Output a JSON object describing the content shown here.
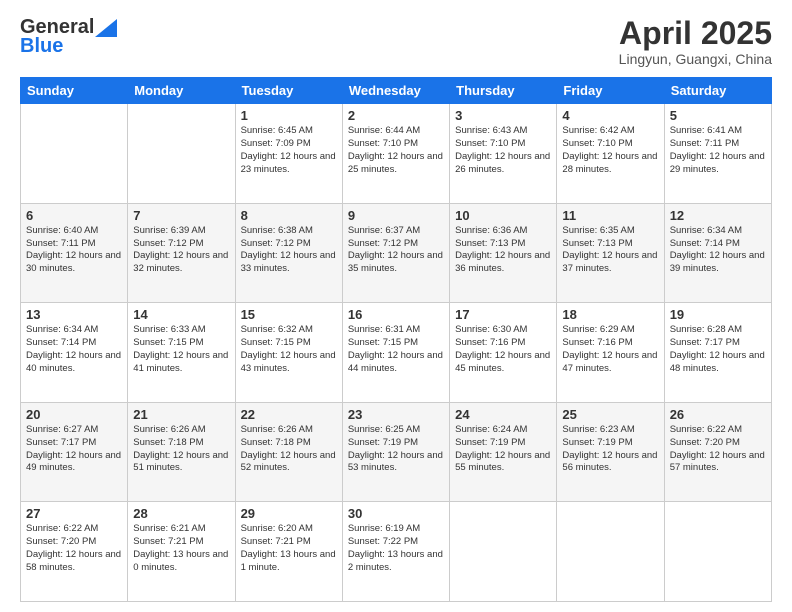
{
  "header": {
    "logo": {
      "general": "General",
      "blue": "Blue"
    },
    "title": "April 2025",
    "location": "Lingyun, Guangxi, China"
  },
  "days_of_week": [
    "Sunday",
    "Monday",
    "Tuesday",
    "Wednesday",
    "Thursday",
    "Friday",
    "Saturday"
  ],
  "weeks": [
    [
      {
        "day": "",
        "info": ""
      },
      {
        "day": "",
        "info": ""
      },
      {
        "day": "1",
        "info": "Sunrise: 6:45 AM\nSunset: 7:09 PM\nDaylight: 12 hours and 23 minutes."
      },
      {
        "day": "2",
        "info": "Sunrise: 6:44 AM\nSunset: 7:10 PM\nDaylight: 12 hours and 25 minutes."
      },
      {
        "day": "3",
        "info": "Sunrise: 6:43 AM\nSunset: 7:10 PM\nDaylight: 12 hours and 26 minutes."
      },
      {
        "day": "4",
        "info": "Sunrise: 6:42 AM\nSunset: 7:10 PM\nDaylight: 12 hours and 28 minutes."
      },
      {
        "day": "5",
        "info": "Sunrise: 6:41 AM\nSunset: 7:11 PM\nDaylight: 12 hours and 29 minutes."
      }
    ],
    [
      {
        "day": "6",
        "info": "Sunrise: 6:40 AM\nSunset: 7:11 PM\nDaylight: 12 hours and 30 minutes."
      },
      {
        "day": "7",
        "info": "Sunrise: 6:39 AM\nSunset: 7:12 PM\nDaylight: 12 hours and 32 minutes."
      },
      {
        "day": "8",
        "info": "Sunrise: 6:38 AM\nSunset: 7:12 PM\nDaylight: 12 hours and 33 minutes."
      },
      {
        "day": "9",
        "info": "Sunrise: 6:37 AM\nSunset: 7:12 PM\nDaylight: 12 hours and 35 minutes."
      },
      {
        "day": "10",
        "info": "Sunrise: 6:36 AM\nSunset: 7:13 PM\nDaylight: 12 hours and 36 minutes."
      },
      {
        "day": "11",
        "info": "Sunrise: 6:35 AM\nSunset: 7:13 PM\nDaylight: 12 hours and 37 minutes."
      },
      {
        "day": "12",
        "info": "Sunrise: 6:34 AM\nSunset: 7:14 PM\nDaylight: 12 hours and 39 minutes."
      }
    ],
    [
      {
        "day": "13",
        "info": "Sunrise: 6:34 AM\nSunset: 7:14 PM\nDaylight: 12 hours and 40 minutes."
      },
      {
        "day": "14",
        "info": "Sunrise: 6:33 AM\nSunset: 7:15 PM\nDaylight: 12 hours and 41 minutes."
      },
      {
        "day": "15",
        "info": "Sunrise: 6:32 AM\nSunset: 7:15 PM\nDaylight: 12 hours and 43 minutes."
      },
      {
        "day": "16",
        "info": "Sunrise: 6:31 AM\nSunset: 7:15 PM\nDaylight: 12 hours and 44 minutes."
      },
      {
        "day": "17",
        "info": "Sunrise: 6:30 AM\nSunset: 7:16 PM\nDaylight: 12 hours and 45 minutes."
      },
      {
        "day": "18",
        "info": "Sunrise: 6:29 AM\nSunset: 7:16 PM\nDaylight: 12 hours and 47 minutes."
      },
      {
        "day": "19",
        "info": "Sunrise: 6:28 AM\nSunset: 7:17 PM\nDaylight: 12 hours and 48 minutes."
      }
    ],
    [
      {
        "day": "20",
        "info": "Sunrise: 6:27 AM\nSunset: 7:17 PM\nDaylight: 12 hours and 49 minutes."
      },
      {
        "day": "21",
        "info": "Sunrise: 6:26 AM\nSunset: 7:18 PM\nDaylight: 12 hours and 51 minutes."
      },
      {
        "day": "22",
        "info": "Sunrise: 6:26 AM\nSunset: 7:18 PM\nDaylight: 12 hours and 52 minutes."
      },
      {
        "day": "23",
        "info": "Sunrise: 6:25 AM\nSunset: 7:19 PM\nDaylight: 12 hours and 53 minutes."
      },
      {
        "day": "24",
        "info": "Sunrise: 6:24 AM\nSunset: 7:19 PM\nDaylight: 12 hours and 55 minutes."
      },
      {
        "day": "25",
        "info": "Sunrise: 6:23 AM\nSunset: 7:19 PM\nDaylight: 12 hours and 56 minutes."
      },
      {
        "day": "26",
        "info": "Sunrise: 6:22 AM\nSunset: 7:20 PM\nDaylight: 12 hours and 57 minutes."
      }
    ],
    [
      {
        "day": "27",
        "info": "Sunrise: 6:22 AM\nSunset: 7:20 PM\nDaylight: 12 hours and 58 minutes."
      },
      {
        "day": "28",
        "info": "Sunrise: 6:21 AM\nSunset: 7:21 PM\nDaylight: 13 hours and 0 minutes."
      },
      {
        "day": "29",
        "info": "Sunrise: 6:20 AM\nSunset: 7:21 PM\nDaylight: 13 hours and 1 minute."
      },
      {
        "day": "30",
        "info": "Sunrise: 6:19 AM\nSunset: 7:22 PM\nDaylight: 13 hours and 2 minutes."
      },
      {
        "day": "",
        "info": ""
      },
      {
        "day": "",
        "info": ""
      },
      {
        "day": "",
        "info": ""
      }
    ]
  ]
}
